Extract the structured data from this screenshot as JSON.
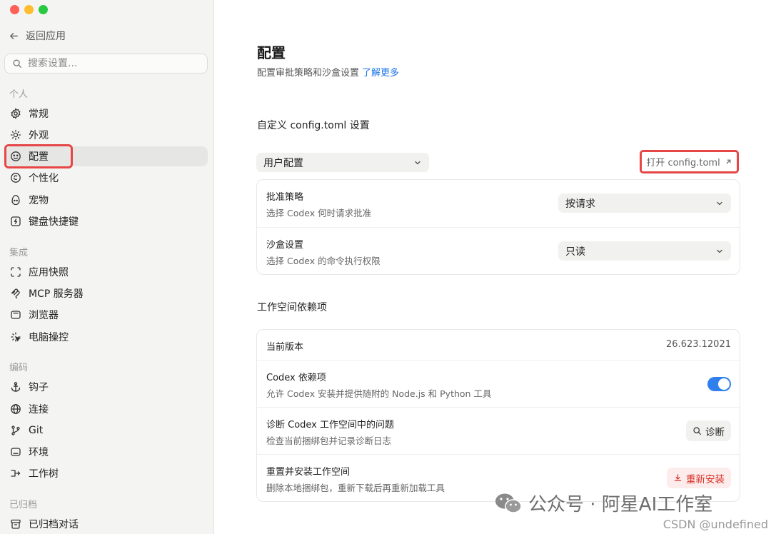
{
  "window": {
    "traffic_lights": [
      "#fe5f57",
      "#febc2e",
      "#28c840"
    ]
  },
  "sidebar": {
    "back_label": "返回应用",
    "search_placeholder": "搜索设置...",
    "groups": [
      {
        "label": "个人",
        "items": [
          {
            "label": "常规",
            "icon": "gear-icon"
          },
          {
            "label": "外观",
            "icon": "sun-icon"
          },
          {
            "label": "配置",
            "icon": "face-icon",
            "active": true
          },
          {
            "label": "个性化",
            "icon": "personalize-icon"
          },
          {
            "label": "宠物",
            "icon": "egg-icon"
          },
          {
            "label": "键盘快捷键",
            "icon": "keyboard-icon"
          }
        ]
      },
      {
        "label": "集成",
        "items": [
          {
            "label": "应用快照",
            "icon": "snapshot-icon"
          },
          {
            "label": "MCP 服务器",
            "icon": "mcp-icon"
          },
          {
            "label": "浏览器",
            "icon": "browser-icon"
          },
          {
            "label": "电脑操控",
            "icon": "computer-control-icon"
          }
        ]
      },
      {
        "label": "编码",
        "items": [
          {
            "label": "钩子",
            "icon": "anchor-icon"
          },
          {
            "label": "连接",
            "icon": "globe-icon"
          },
          {
            "label": "Git",
            "icon": "git-branch-icon"
          },
          {
            "label": "环境",
            "icon": "terminal-icon"
          },
          {
            "label": "工作树",
            "icon": "worktree-icon"
          }
        ]
      },
      {
        "label": "已归档",
        "items": [
          {
            "label": "已归档对话",
            "icon": "archive-icon"
          }
        ]
      }
    ]
  },
  "main": {
    "title": "配置",
    "subtitle": "配置审批策略和沙盒设置",
    "learn_more": "了解更多",
    "custom_section": {
      "title": "自定义 config.toml 设置",
      "profile_select": "用户配置",
      "open_button": "打开 config.toml",
      "rows": [
        {
          "title": "批准策略",
          "desc": "选择 Codex 何时请求批准",
          "value": "按请求"
        },
        {
          "title": "沙盒设置",
          "desc": "选择 Codex 的命令执行权限",
          "value": "只读"
        }
      ]
    },
    "workspace_section": {
      "title": "工作空间依赖项",
      "version_row": {
        "title": "当前版本",
        "value": "26.623.12021"
      },
      "deps_row": {
        "title": "Codex 依赖项",
        "desc": "允许 Codex 安装并提供随附的 Node.js 和 Python 工具",
        "enabled": true
      },
      "diagnose_row": {
        "title": "诊断 Codex 工作空间中的问题",
        "desc": "检查当前捆绑包并记录诊断日志",
        "button": "诊断"
      },
      "reset_row": {
        "title": "重置并安装工作空间",
        "desc": "删除本地捆绑包，重新下载后再重新加载工具",
        "button": "重新安装"
      }
    }
  },
  "watermark": {
    "text": "公众号 · 阿星AI工作室",
    "credit": "CSDN @undefined"
  }
}
